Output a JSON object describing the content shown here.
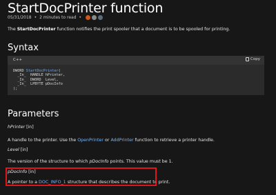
{
  "title": "StartDocPrinter function",
  "meta": {
    "date": "05/31/2018",
    "separator": "•",
    "read_time": "2 minutes to read",
    "separator2": "•"
  },
  "intro": {
    "prefix": "The ",
    "bold": "StartDocPrinter",
    "suffix": " function notifies the print spooler that a document is to be spooled for printing."
  },
  "syntax": {
    "heading": "Syntax",
    "lang": "C++",
    "copy_label": "Copy",
    "code_lines": [
      {
        "type": "DWORD ",
        "fn": "StartDocPrinter",
        "rest": "("
      },
      {
        "type": "  _In_  HANDLE ",
        "fn": "",
        "rest": "hPrinter,"
      },
      {
        "type": "  _In_  DWORD  ",
        "fn": "",
        "rest": "Level,"
      },
      {
        "type": "  _In_  LPBYTE ",
        "fn": "",
        "rest": "pDocInfo"
      },
      {
        "type": ");",
        "fn": "",
        "rest": ""
      }
    ]
  },
  "parameters": {
    "heading": "Parameters",
    "items": [
      {
        "name": "hPrinter",
        "tag": " [in]",
        "desc_prefix": "A handle to the printer. Use the ",
        "link1": "OpenPrinter",
        "mid": " or ",
        "link2": "AddPrinter",
        "desc_suffix": " function to retrieve a printer handle."
      },
      {
        "name": "Level",
        "tag": " [in]",
        "desc_prefix": "The version of the structure to which ",
        "em": "pDocInfo",
        "desc_suffix": " points. This value must be 1."
      },
      {
        "name": "pDocInfo",
        "tag": " [in]",
        "desc_prefix": "A pointer to a ",
        "link1": "DOC_INFO_1",
        "desc_suffix": " structure that describes the document to print."
      }
    ]
  },
  "colors": {
    "highlight": "#e0161b",
    "link": "#75b6ff",
    "background": "#171717"
  }
}
